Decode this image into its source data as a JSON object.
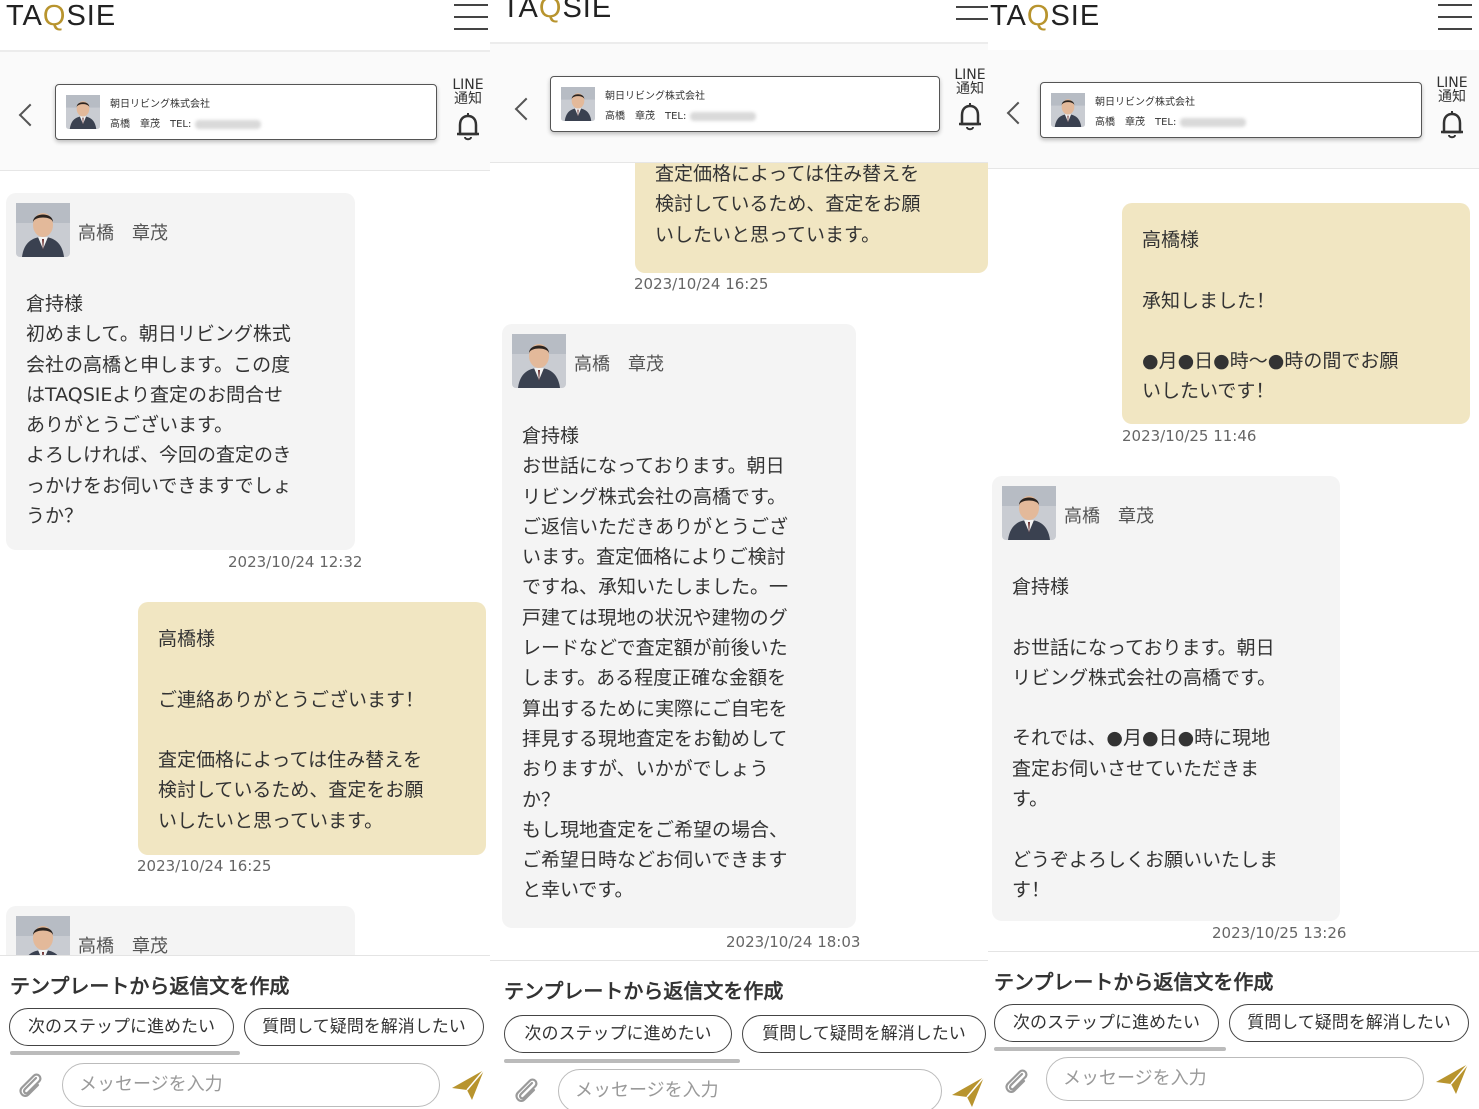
{
  "app": {
    "logo_left": "TA",
    "logo_q": "Q",
    "logo_right": "SIE"
  },
  "contact": {
    "company": "朝日リビング株式会社",
    "person": "高橋　章茂",
    "tel_label": "TEL:",
    "line_label_1": "LINE",
    "line_label_2": "通知"
  },
  "agent_name": "高橋　章茂",
  "colors": {
    "sent_bubble": "#f1e6c2",
    "recv_bubble": "#f4f4f4",
    "logo_accent": "#b8942e"
  },
  "icons": [
    "menu-icon",
    "back-icon",
    "bell-icon",
    "clip-icon",
    "send-icon",
    "avatar"
  ],
  "footer": {
    "template_title": "テンプレートから返信文を作成",
    "btn_next": "次のステップに進めたい",
    "btn_question": "質問して疑問を解消したい",
    "input_placeholder": "メッセージを入力"
  },
  "screens": [
    {
      "messages": [
        {
          "type": "received",
          "text": "倉持様\n初めまして。朝日リビング株式\n会社の高橋と申します。この度\nはTAQSIEより査定のお問合せ\nありがとうございます。\nよろしければ、今回の査定のき\nっかけをお伺いできますでしょ\nうか？",
          "time": "2023/10/24 12:32"
        },
        {
          "type": "sent",
          "text": "高橋様\n\nご連絡ありがとうございます！\n\n査定価格によっては住み替えを\n検討しているため、査定をお願\nいしたいと思っています。",
          "time": "2023/10/24 16:25"
        },
        {
          "type": "received_partial"
        }
      ]
    },
    {
      "messages": [
        {
          "type": "sent",
          "text": "査定価格によっては住み替えを\n検討しているため、査定をお願\nいしたいと思っています。",
          "time": "2023/10/24 16:25"
        },
        {
          "type": "received",
          "text": "倉持様\nお世話になっております。朝日\nリビング株式会社の高橋です。\nご返信いただきありがとうござ\nいます。査定価格によりご検討\nですね、承知いたしました。一\n戸建ては現地の状況や建物のグ\nレードなどで査定額が前後いた\nします。ある程度正確な金額を\n算出するために実際にご自宅を\n拝見する現地査定をお勧めして\nおりますが、いかがでしょう\nか？\nもし現地査定をご希望の場合、\nご希望日時などお伺いできます\nと幸いです。",
          "time": "2023/10/24 18:03"
        }
      ]
    },
    {
      "messages": [
        {
          "type": "sent",
          "text": "高橋様\n\n承知しました！\n\n●月●日●時～●時の間でお願\nいしたいです！",
          "time": "2023/10/25 11:46"
        },
        {
          "type": "received",
          "text": "倉持様\n\nお世話になっております。朝日\nリビング株式会社の高橋です。\n\nそれでは、●月●日●時に現地\n査定お伺いさせていただきま\nす。\n\nどうぞよろしくお願いいたしま\nす！",
          "time": "2023/10/25 13:26"
        }
      ]
    }
  ]
}
